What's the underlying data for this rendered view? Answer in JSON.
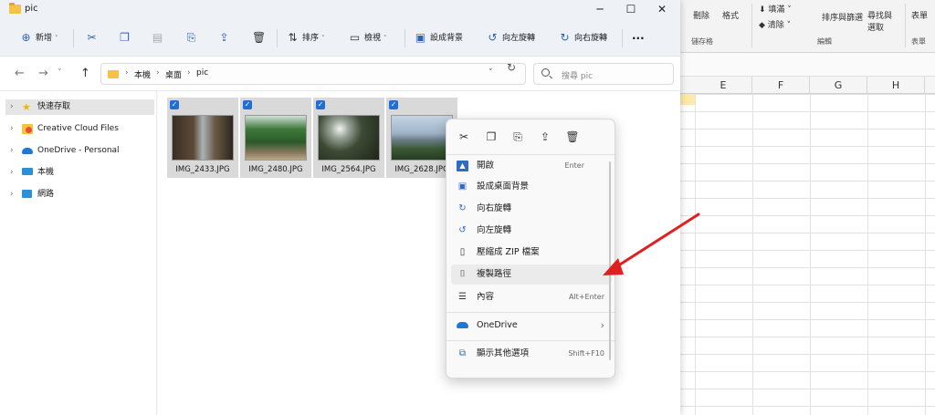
{
  "excel": {
    "ribbon": {
      "delete": "刪除",
      "format": "格式",
      "fill": "填滿",
      "clear": "清除",
      "sort_filter": "排序與篩選",
      "find_select_1": "尋找與",
      "find_select_2": "選取",
      "form": "表單",
      "group_cells": "儲存格",
      "group_edit": "編輯",
      "group_form": "表單"
    },
    "columns": [
      "E",
      "F",
      "G",
      "H"
    ]
  },
  "window": {
    "title": "pic",
    "minimize": "─",
    "maximize": "☐",
    "close": "✕"
  },
  "toolbar": {
    "new_label": "新增",
    "sort_label": "排序",
    "view_label": "檢視",
    "set_bg_label": "設成背景",
    "rotate_left_label": "向左旋轉",
    "rotate_right_label": "向右旋轉",
    "more_label": "···"
  },
  "address": {
    "crumbs": [
      "本機",
      "桌面",
      "pic"
    ],
    "search_placeholder": "搜尋 pic"
  },
  "nav": {
    "items": [
      {
        "label": "快速存取",
        "icon": "star-icon"
      },
      {
        "label": "Creative Cloud Files",
        "icon": "creative-cloud-icon"
      },
      {
        "label": "OneDrive - Personal",
        "icon": "onedrive-icon"
      },
      {
        "label": "本機",
        "icon": "computer-icon"
      },
      {
        "label": "網路",
        "icon": "network-icon"
      }
    ]
  },
  "files": [
    {
      "name": "IMG_2433.JPG"
    },
    {
      "name": "IMG_2480.JPG"
    },
    {
      "name": "IMG_2564.JPG"
    },
    {
      "name": "IMG_2628.JPG"
    }
  ],
  "context_menu": {
    "items": [
      {
        "label": "開啟",
        "shortcut": "Enter"
      },
      {
        "label": "設成桌面背景",
        "shortcut": ""
      },
      {
        "label": "向右旋轉",
        "shortcut": ""
      },
      {
        "label": "向左旋轉",
        "shortcut": ""
      },
      {
        "label": "壓縮成 ZIP 檔案",
        "shortcut": ""
      },
      {
        "label": "複製路徑",
        "shortcut": ""
      },
      {
        "label": "內容",
        "shortcut": "Alt+Enter"
      },
      {
        "label": "OneDrive",
        "shortcut": "›"
      },
      {
        "label": "顯示其他選項",
        "shortcut": "Shift+F10"
      }
    ]
  },
  "colors": {
    "accent": "#1e6fd9",
    "annotation_arrow": "#e02020"
  }
}
